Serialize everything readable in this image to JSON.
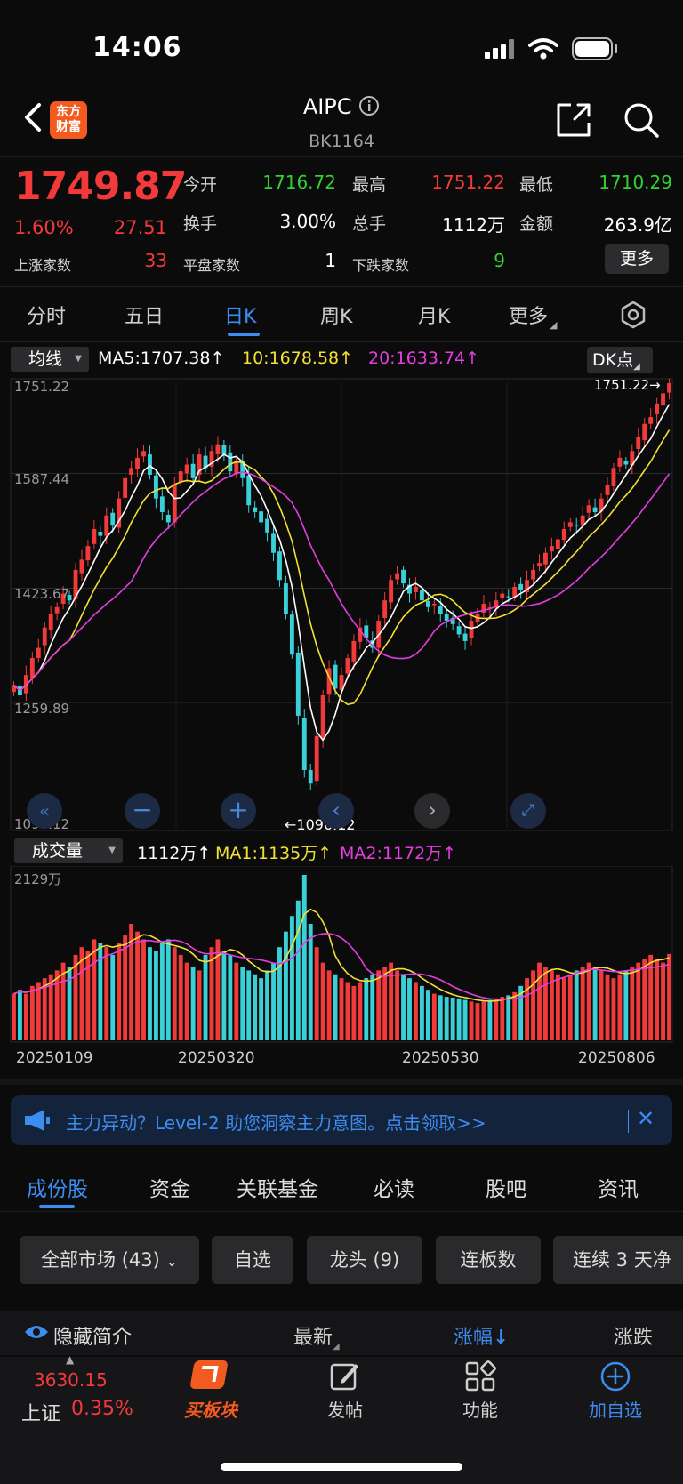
{
  "status_bar": {
    "time": "14:06"
  },
  "header": {
    "logo_line1": "东方",
    "logo_line2": "财富",
    "title": "AIPC",
    "code": "BK1164"
  },
  "quote": {
    "price": "1749.87",
    "change_pct": "1.60%",
    "change_amt": "27.51",
    "open_label": "今开",
    "open": "1716.72",
    "high_label": "最高",
    "high": "1751.22",
    "low_label": "最低",
    "low": "1710.29",
    "turnover_label": "换手",
    "turnover": "3.00%",
    "volume_label": "总手",
    "volume": "1112万",
    "amount_label": "金额",
    "amount": "263.9亿",
    "up_label": "上涨家数",
    "up_count": "33",
    "flat_label": "平盘家数",
    "flat_count": "1",
    "down_label": "下跌家数",
    "down_count": "9",
    "more": "更多"
  },
  "tabs": [
    "分时",
    "五日",
    "日K",
    "周K",
    "月K",
    "更多"
  ],
  "indicator_bar": {
    "ma_dropdown": "均线",
    "ma5": "MA5:1707.38↑",
    "ma10": "10:1678.58↑",
    "ma20": "20:1633.74↑",
    "dk": "DK点"
  },
  "price_axis": [
    "1751.22",
    "1587.44",
    "1423.67",
    "1259.89",
    "1096.12"
  ],
  "price_markers": {
    "high": "1751.22→",
    "low": "←1096.12"
  },
  "volume_bar": {
    "dropdown": "成交量",
    "vol": "1112万↑",
    "ma1": "MA1:1135万↑",
    "ma2": "MA2:1172万↑",
    "max": "2129万"
  },
  "date_axis": [
    "20250109",
    "20250320",
    "20250530",
    "20250806"
  ],
  "banner": {
    "text": "主力异动？Level-2 助您洞察主力意图。点击领取>>"
  },
  "bottom_tabs": [
    "成份股",
    "资金",
    "关联基金",
    "必读",
    "股吧",
    "资讯"
  ],
  "chips": [
    "全部市场 (43)",
    "自选",
    "龙头 (9)",
    "连板数",
    "连续 3 天净"
  ],
  "table_header": {
    "hide": "隐藏简介",
    "latest": "最新",
    "pct": "涨幅",
    "chg": "涨跌"
  },
  "bottom_nav": {
    "index_value": "3630.15",
    "index_name": "上证",
    "index_pct": "0.35%",
    "buy": "买板块",
    "post": "发帖",
    "func": "功能",
    "add": "加自选"
  },
  "colors": {
    "up": "#f23a3a",
    "down": "#39d0d8",
    "ma5": "#ffffff",
    "ma10": "#f3e133",
    "ma20": "#e43ee0",
    "accent": "#3d8cf0"
  },
  "chart_data": {
    "type": "candlestick",
    "price_range": [
      1096.12,
      1751.22
    ],
    "volume_max": 2129,
    "close": [
      1305,
      1290,
      1320,
      1345,
      1360,
      1390,
      1410,
      1420,
      1440,
      1430,
      1475,
      1490,
      1510,
      1535,
      1525,
      1555,
      1540,
      1580,
      1610,
      1625,
      1640,
      1650,
      1615,
      1580,
      1560,
      1545,
      1600,
      1620,
      1630,
      1610,
      1645,
      1625,
      1650,
      1660,
      1645,
      1620,
      1635,
      1610,
      1570,
      1560,
      1545,
      1530,
      1500,
      1460,
      1410,
      1350,
      1260,
      1180,
      1160,
      1230,
      1290,
      1330,
      1300,
      1320,
      1345,
      1370,
      1390,
      1375,
      1360,
      1400,
      1430,
      1460,
      1470,
      1455,
      1440,
      1450,
      1430,
      1420,
      1425,
      1410,
      1400,
      1395,
      1380,
      1370,
      1400,
      1410,
      1425,
      1420,
      1430,
      1440,
      1435,
      1450,
      1445,
      1460,
      1475,
      1485,
      1500,
      1510,
      1520,
      1535,
      1545,
      1540,
      1555,
      1570,
      1560,
      1580,
      1600,
      1625,
      1640,
      1630,
      1650,
      1670,
      1690,
      1700,
      1720,
      1735,
      1749.87
    ],
    "volume": [
      600,
      650,
      600,
      700,
      750,
      800,
      850,
      900,
      1000,
      950,
      1100,
      1200,
      1150,
      1300,
      1250,
      1200,
      1100,
      1250,
      1350,
      1500,
      1400,
      1300,
      1200,
      1150,
      1250,
      1300,
      1200,
      1100,
      1000,
      950,
      900,
      1100,
      1200,
      1300,
      1150,
      1100,
      1000,
      950,
      900,
      850,
      800,
      900,
      1000,
      1200,
      1400,
      1600,
      1800,
      2129,
      1500,
      1200,
      1000,
      900,
      850,
      800,
      750,
      700,
      750,
      800,
      850,
      900,
      950,
      1000,
      900,
      850,
      800,
      750,
      700,
      650,
      600,
      580,
      560,
      550,
      540,
      520,
      500,
      480,
      500,
      520,
      540,
      560,
      580,
      620,
      700,
      800,
      900,
      1000,
      950,
      900,
      850,
      800,
      850,
      900,
      950,
      1000,
      950,
      900,
      850,
      800,
      850,
      900,
      950,
      1000,
      1050,
      1100,
      1050,
      1000,
      1112
    ]
  }
}
